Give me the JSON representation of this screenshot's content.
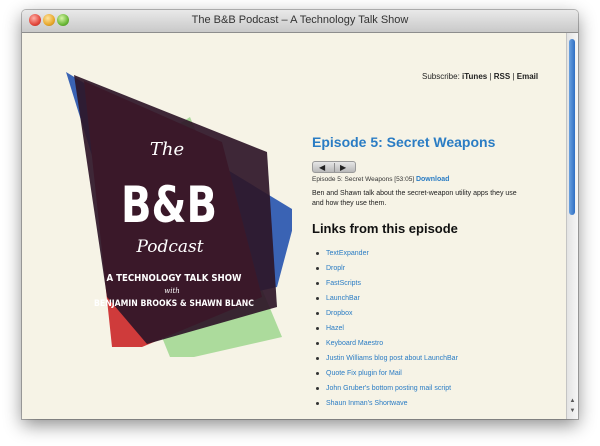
{
  "window": {
    "title": "The B&B Podcast – A Technology Talk Show"
  },
  "logo": {
    "line1": "The",
    "line2": "B&B",
    "line3": "Podcast",
    "tagline": "A TECHNOLOGY TALK SHOW",
    "with": "with",
    "hosts": "BENJAMIN BROOKS & SHAWN BLANC",
    "colors": {
      "blue": "#3a63b4",
      "red": "#cf3b3b",
      "green": "#9fd68e",
      "dark": "#2e1628"
    }
  },
  "subscribe": {
    "label": "Subscribe:",
    "itunes": "iTunes",
    "sep": "|",
    "rss": "RSS",
    "email": "Email"
  },
  "episode": {
    "title": "Episode 5: Secret Weapons",
    "meta": "Episode 5: Secret Weapons [53:05]",
    "download": "Download",
    "description": "Ben and Shawn talk about the secret-weapon utility apps they use and how they use them."
  },
  "links_heading": "Links from this episode",
  "links": [
    "TextExpander",
    "Droplr",
    "FastScripts",
    "LaunchBar",
    "Dropbox",
    "Hazel",
    "Keyboard Maestro",
    "Justin Williams blog post about LaunchBar",
    "Quote Fix plugin for Mail",
    "John Gruber's bottom posting mail script",
    "Shaun Inman's Shortwave"
  ],
  "icons": {
    "rewind": "◀",
    "play": "▶",
    "scroll_up": "▲",
    "scroll_down": "▼"
  }
}
